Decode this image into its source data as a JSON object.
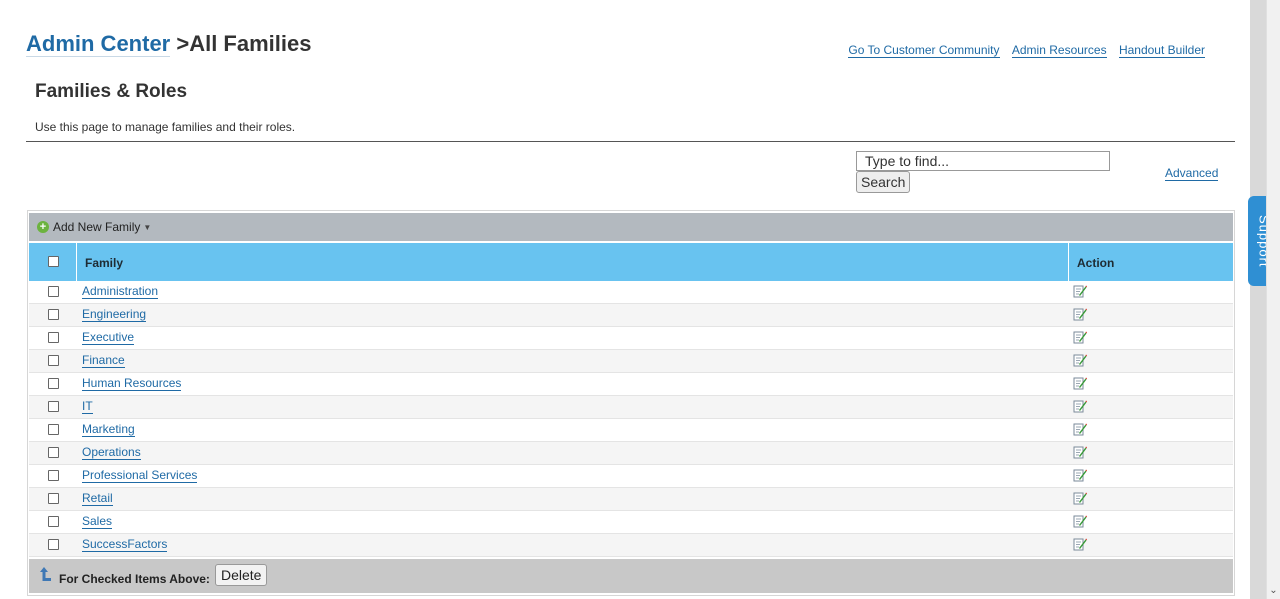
{
  "header": {
    "breadcrumb_link": "Admin Center",
    "breadcrumb_rest": " >All Families",
    "links": [
      "Go To Customer Community",
      "Admin Resources",
      "Handout Builder"
    ]
  },
  "section": {
    "title": "Families & Roles",
    "description": "Use this page to manage families and their roles."
  },
  "search": {
    "placeholder": "Type to find...",
    "button_label": "Search",
    "advanced_label": "Advanced"
  },
  "toolbar": {
    "add_label": "Add New Family"
  },
  "table": {
    "columns": {
      "family": "Family",
      "action": "Action"
    },
    "rows": [
      {
        "family": "Administration"
      },
      {
        "family": "Engineering"
      },
      {
        "family": "Executive"
      },
      {
        "family": "Finance"
      },
      {
        "family": "Human Resources"
      },
      {
        "family": "IT"
      },
      {
        "family": "Marketing"
      },
      {
        "family": "Operations"
      },
      {
        "family": "Professional Services"
      },
      {
        "family": "Retail"
      },
      {
        "family": "Sales"
      },
      {
        "family": "SuccessFactors"
      }
    ]
  },
  "footer": {
    "label": "For Checked Items Above:",
    "delete_label": "Delete"
  },
  "support_tab": "Support",
  "colors": {
    "link": "#1f6aa5",
    "table_header": "#68c3f0",
    "toolbar": "#b3b9bf",
    "support_tab": "#2f8fd3"
  },
  "icons": [
    "plus-icon",
    "caret-down-icon",
    "edit-icon",
    "up-arrow-icon",
    "chevron-down-icon"
  ]
}
